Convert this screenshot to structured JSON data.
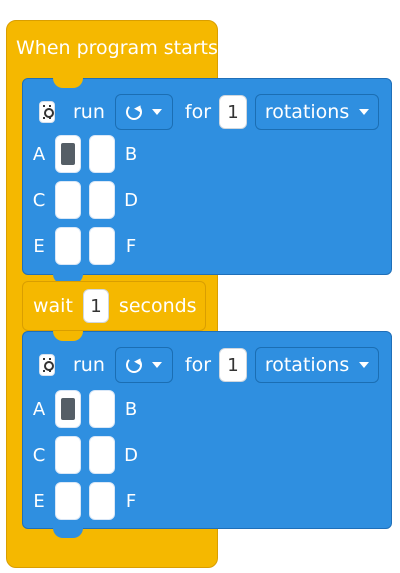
{
  "hat": {
    "title": "When program starts"
  },
  "block1": {
    "run": "run",
    "for": "for",
    "value": "1",
    "unit": "rotations",
    "ports": [
      "A",
      "B",
      "C",
      "D",
      "E",
      "F"
    ],
    "selected_port": "A"
  },
  "wait": {
    "label": "wait",
    "value": "1",
    "unit": "seconds"
  },
  "block2": {
    "run": "run",
    "for": "for",
    "value": "1",
    "unit": "rotations",
    "ports": [
      "A",
      "B",
      "C",
      "D",
      "E",
      "F"
    ],
    "selected_port": "A"
  },
  "colors": {
    "hat": "#f5b800",
    "block": "#2f8fe0",
    "port": "#ffffff"
  },
  "icons": {
    "hub": "motor-icon",
    "direction": "rotate-clockwise-icon"
  }
}
